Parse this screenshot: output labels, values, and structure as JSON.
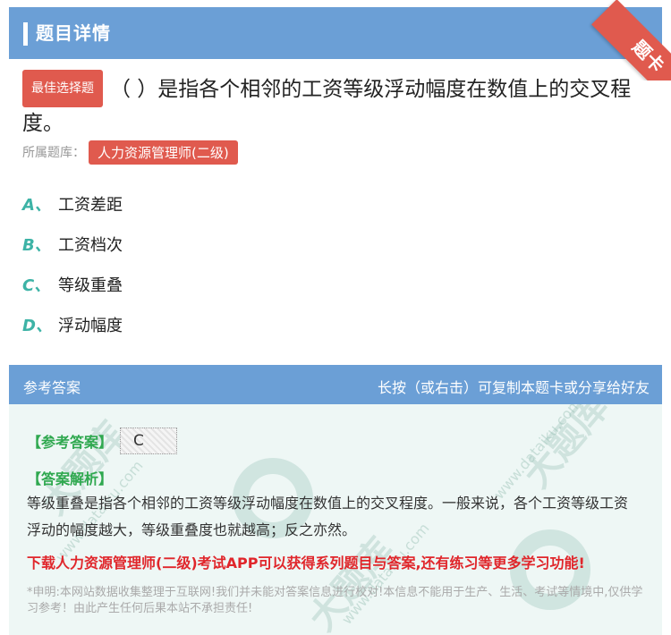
{
  "header": {
    "title": "题目详情",
    "corner_label": "题卡",
    "colors": {
      "bar": "#6b9fd6",
      "ribbon": "#e05a4e"
    }
  },
  "question": {
    "type_badge": "最佳选择题",
    "text": "（ ）是指各个相邻的工资等级浮动幅度在数值上的交叉程度。",
    "bank_label": "所属题库：",
    "bank_name": "人力资源管理师(二级)"
  },
  "options": [
    {
      "letter": "A、",
      "text": "工资差距"
    },
    {
      "letter": "B、",
      "text": "工资档次"
    },
    {
      "letter": "C、",
      "text": "等级重叠"
    },
    {
      "letter": "D、",
      "text": "浮动幅度"
    }
  ],
  "answer_section": {
    "header_left": "参考答案",
    "header_right": "长按（或右击）可复制本题卡或分享给好友",
    "ref_label": "【参考答案】",
    "ref_value": "C",
    "analysis_label": "【答案解析】",
    "analysis_text": "等级重叠是指各个相邻的工资等级浮动幅度在数值上的交叉程度。一般来说，各个工资等级工资浮动的幅度越大，等级重叠度也就越高；反之亦然。",
    "promo": "下载人力资源管理师(二级)考试APP可以获得系列题目与答案,还有练习等更多学习功能!",
    "disclaimer": "*申明:本网站数据收集整理于互联网!我们并未能对答案信息进行校对!本信息不能用于生产、生活、考试等情境中,仅供学习参考！由此产生任何后果本站不承担责任!"
  },
  "watermark": {
    "text": "大题库",
    "url": "www.dataiku.com"
  }
}
